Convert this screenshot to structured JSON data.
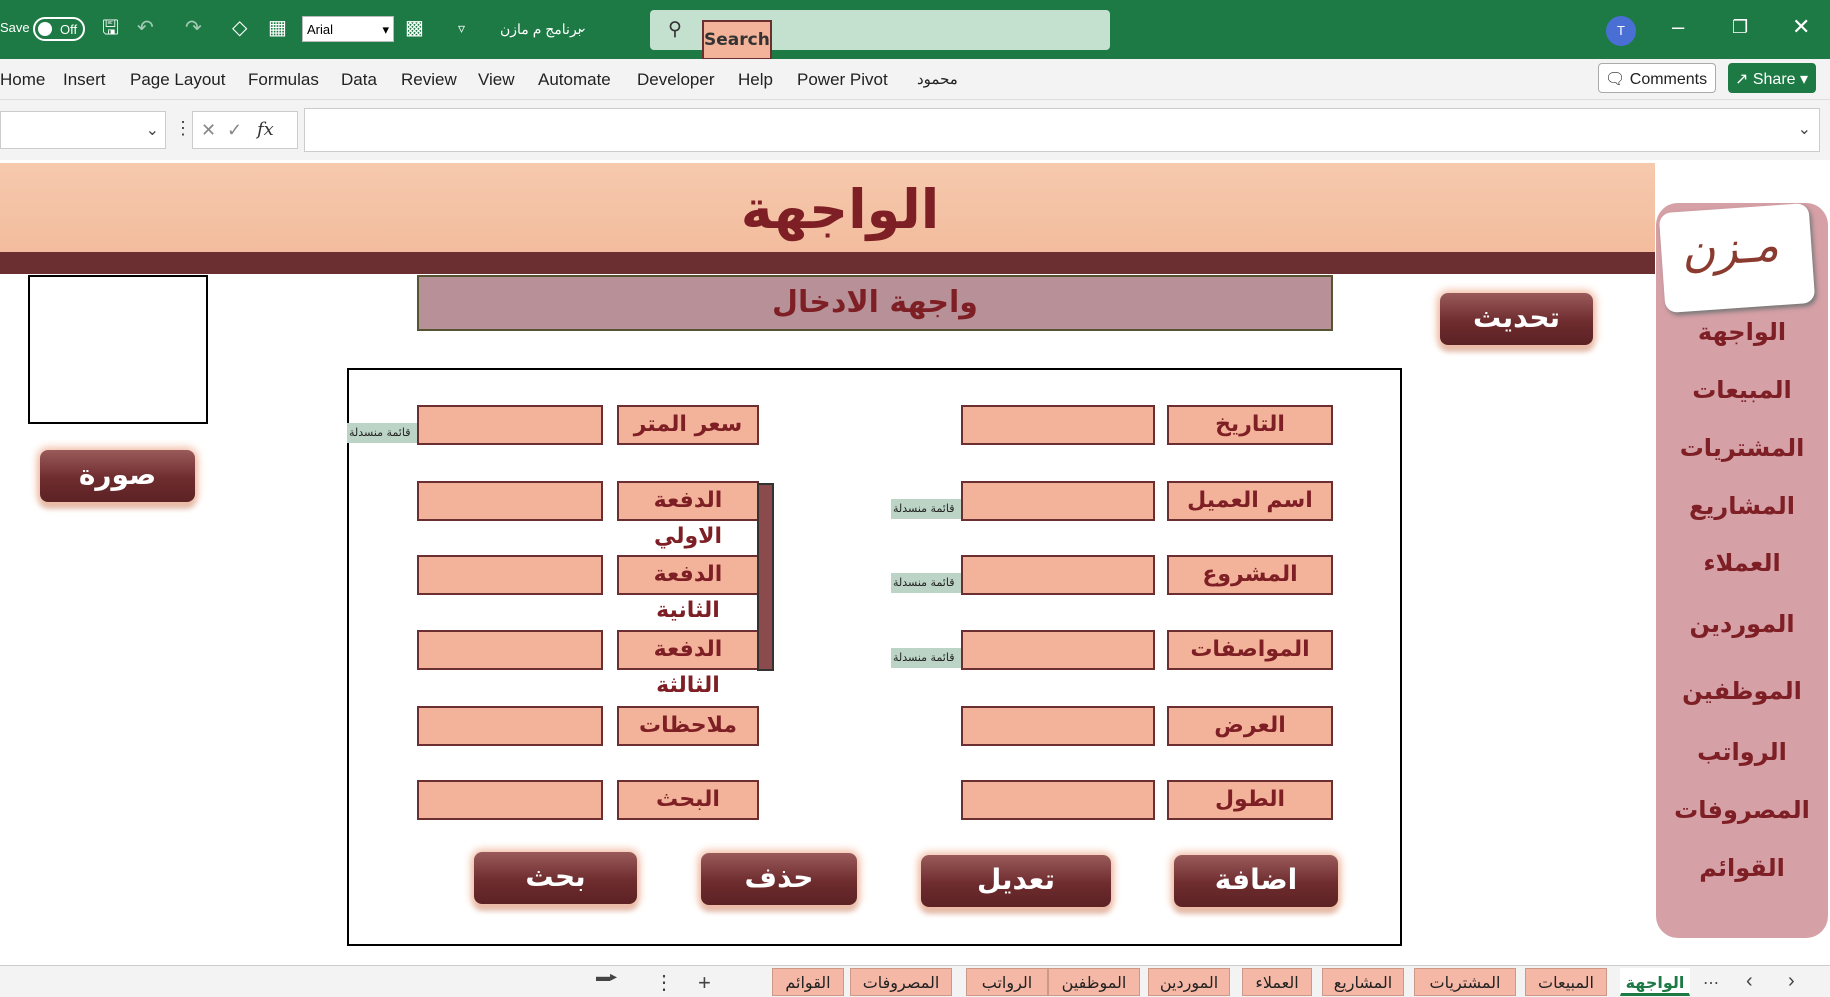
{
  "titlebar": {
    "autosave_label": "Save",
    "autosave_state": "Off",
    "font_name": "Arial",
    "workbook_name": "برنامج م مازن",
    "search_placeholder": "Search",
    "avatar_initial": "T",
    "icons": [
      "save-icon",
      "undo-icon",
      "redo-icon",
      "eraser-icon",
      "table-icon",
      "format-icon",
      "customize-icon",
      "search-icon",
      "minimize-icon",
      "restore-icon",
      "close-icon"
    ]
  },
  "ribbon": {
    "tabs": [
      "Home",
      "Insert",
      "Page Layout",
      "Formulas",
      "Data",
      "Review",
      "View",
      "Automate",
      "Developer",
      "Help",
      "Power Pivot",
      "محمود"
    ],
    "comments_label": "Comments",
    "share_label": "Share"
  },
  "formula_bar": {
    "fx_label": "fx"
  },
  "sheet": {
    "title": "الواجهة",
    "subtitle": "واجهة الادخال",
    "refresh_button": "تحديث",
    "photo_button": "صورة",
    "sidebar_items": [
      "الواجهة",
      "المبيعات",
      "المشتريات",
      "المشاريع",
      "العملاء",
      "الموردين",
      "الموظفين",
      "الرواتب",
      "المصروفات",
      "القوائم"
    ],
    "right_labels": [
      "التاريخ",
      "اسم العميل",
      "المشروع",
      "المواصفات",
      "العرض",
      "الطول"
    ],
    "left_labels": [
      "سعر المتر",
      "الدفعة الاولي",
      "الدفعة الثانية",
      "الدفعة الثالثة",
      "ملاحظات",
      "البحث"
    ],
    "dropdown_note": "قائمة منسدلة",
    "actions": {
      "add": "اضافة",
      "edit": "تعديل",
      "delete": "حذف",
      "search": "بحث"
    }
  },
  "sheet_tabs": [
    "القوائم",
    "المصروفات",
    "الرواتب",
    "الموظفين",
    "الموردين",
    "العملاء",
    "المشاريع",
    "المشتريات",
    "المبيعات",
    "الواجهة"
  ],
  "colors": {
    "excel_green": "#1d7a44",
    "maroon": "#7d1f24",
    "peach": "#f3b39b",
    "sidebar": "#d5a0a6"
  }
}
